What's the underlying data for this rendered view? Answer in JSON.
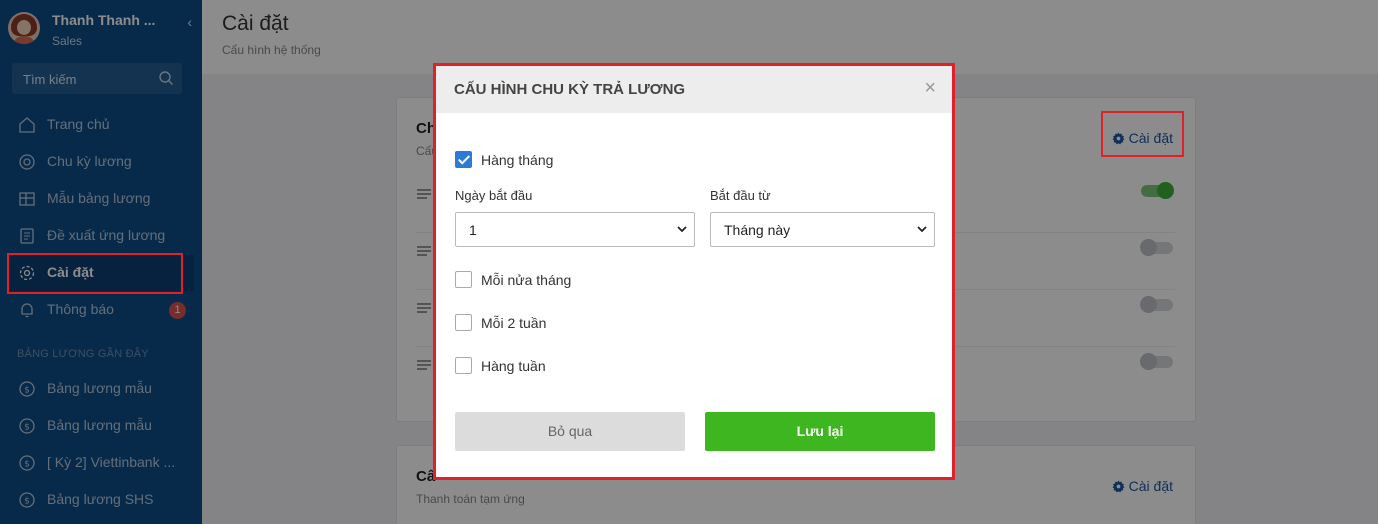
{
  "sidebar": {
    "user_name": "Thanh Thanh ...",
    "user_role": "Sales",
    "search_placeholder": "Tìm kiếm",
    "items": [
      {
        "label": "Trang chủ",
        "icon": "home-icon"
      },
      {
        "label": "Chu kỳ lương",
        "icon": "cycle-icon"
      },
      {
        "label": "Mẫu bảng lương",
        "icon": "table-icon"
      },
      {
        "label": "Đề xuất ứng lương",
        "icon": "document-icon"
      },
      {
        "label": "Cài đặt",
        "icon": "gear-icon",
        "active": true
      },
      {
        "label": "Thông báo",
        "icon": "bell-icon",
        "badge": "1"
      }
    ],
    "recent_title": "BẢNG LƯƠNG GẦN ĐÂY",
    "recent_items": [
      {
        "label": "Bảng lương mẫu",
        "icon": "dollar-icon"
      },
      {
        "label": "Bảng lương mẫu",
        "icon": "dollar-icon"
      },
      {
        "label": "[ Kỳ 2] Viettinbank ...",
        "icon": "dollar-icon"
      },
      {
        "label": "Bảng lương SHS",
        "icon": "dollar-icon"
      }
    ]
  },
  "header": {
    "title": "Cài đặt",
    "subtitle": "Cấu hình hệ thống"
  },
  "cards": [
    {
      "title_visible": "Ch",
      "sub_visible": "Cấu",
      "settings_label": "Cài đặt"
    },
    {
      "title_visible": "Câ",
      "sub_visible": "Thanh toán tạm ứng",
      "settings_label": "Cài đặt"
    }
  ],
  "toggles": [
    "on",
    "off",
    "off",
    "off"
  ],
  "modal": {
    "title": "CẤU HÌNH CHU KỲ TRẢ LƯƠNG",
    "options": [
      {
        "label": "Hàng tháng",
        "checked": true
      },
      {
        "label": "Mỗi nửa tháng",
        "checked": false
      },
      {
        "label": "Mỗi 2 tuần",
        "checked": false
      },
      {
        "label": "Hàng tuần",
        "checked": false
      }
    ],
    "start_day_label": "Ngày bắt đầu",
    "start_day_value": "1",
    "start_from_label": "Bắt đầu từ",
    "start_from_value": "Tháng này",
    "cancel_label": "Bỏ qua",
    "save_label": "Lưu lại"
  },
  "colors": {
    "sidebar_bg": "#0e4e88",
    "highlight_border": "#e0212a",
    "save_button": "#3db61f",
    "link": "#1e56a0"
  }
}
